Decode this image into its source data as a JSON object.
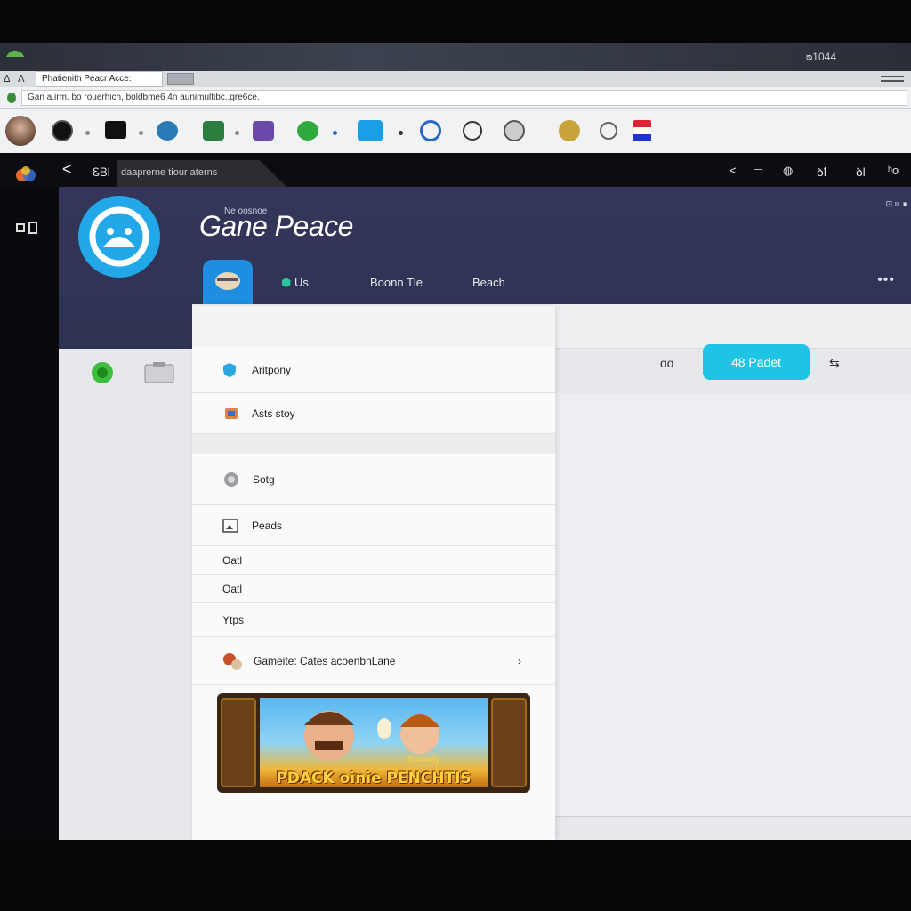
{
  "titlebar": {
    "clock": "ᴓ1044"
  },
  "tabstrip": {
    "active_tab": "Phatienith Peacr Acce:",
    "nav_back": "ᐃ",
    "nav_up": "ᐱ"
  },
  "address": {
    "value": "Gan a.irm. bo rouerhich, boldbme6 4n aunimultibc..gre6ce."
  },
  "appbar": {
    "back": "<",
    "count": "ᏋᏴl",
    "search": "daaprerne tiour aterns",
    "icons": [
      "<",
      "▭",
      "◍",
      "ꝺꝉ",
      "ꝺl",
      "ʰo"
    ]
  },
  "hero": {
    "kicker": "Ne oosnoe",
    "title": "Gane Peace",
    "badge": "⊡ ıʟ.∎",
    "more": "•••",
    "nav": [
      {
        "label": "Us"
      },
      {
        "label": "Boonn Tle"
      },
      {
        "label": "Beach"
      }
    ]
  },
  "toolbar": {
    "pager": "ɑɑ",
    "primary": "48 Padet",
    "shuffle": "⇆"
  },
  "menu": {
    "items": [
      {
        "label": "Aritpony"
      },
      {
        "label": "Asts stoy"
      },
      {
        "label": "Sotg"
      },
      {
        "label": "Peads"
      },
      {
        "label": "Oatl"
      },
      {
        "label": "Oatl"
      },
      {
        "label": "Ytps"
      },
      {
        "label": "Gameite: Cates acoenbnLane",
        "arrow": "›"
      }
    ]
  },
  "banner": {
    "text": "PDACK oinie PENCHTIS",
    "subtitle": "Gainoly"
  },
  "colors": {
    "accent": "#1ec4e4",
    "hero_bg": "#33365a",
    "logo_blue": "#22a7e8"
  }
}
